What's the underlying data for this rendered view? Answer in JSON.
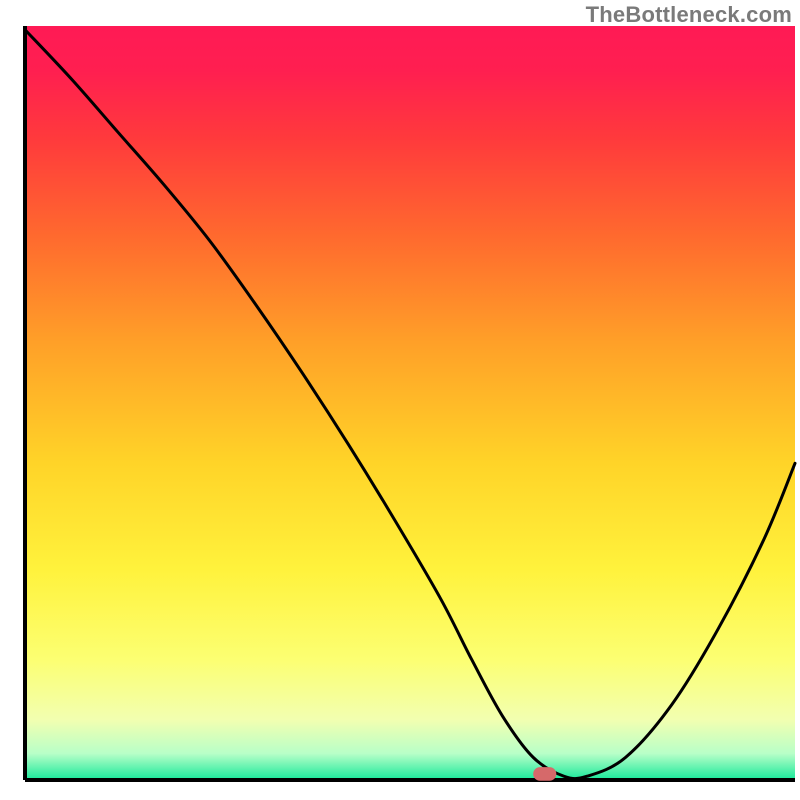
{
  "watermark": "TheBottleneck.com",
  "chart_data": {
    "type": "line",
    "title": "",
    "xlabel": "",
    "ylabel": "",
    "xlim": [
      0,
      100
    ],
    "ylim": [
      0,
      100
    ],
    "background_gradient": {
      "stops": [
        {
          "offset": 0.0,
          "color": "#ff1a55"
        },
        {
          "offset": 0.06,
          "color": "#ff1f50"
        },
        {
          "offset": 0.15,
          "color": "#ff3a3c"
        },
        {
          "offset": 0.28,
          "color": "#ff6a2e"
        },
        {
          "offset": 0.42,
          "color": "#ffa028"
        },
        {
          "offset": 0.58,
          "color": "#ffd428"
        },
        {
          "offset": 0.72,
          "color": "#fff23c"
        },
        {
          "offset": 0.84,
          "color": "#fcff72"
        },
        {
          "offset": 0.92,
          "color": "#f2ffb0"
        },
        {
          "offset": 0.965,
          "color": "#b8ffc8"
        },
        {
          "offset": 1.0,
          "color": "#16e89a"
        }
      ]
    },
    "series": [
      {
        "name": "bottleneck-curve",
        "x": [
          0.0,
          6.0,
          12.0,
          18.0,
          24.0,
          30.0,
          36.0,
          42.0,
          48.0,
          54.0,
          58.0,
          62.0,
          66.0,
          70.0,
          73.0,
          78.0,
          84.0,
          90.0,
          96.0,
          100.0
        ],
        "y": [
          99.5,
          93.0,
          86.0,
          79.0,
          71.5,
          63.0,
          54.0,
          44.5,
          34.5,
          24.0,
          16.0,
          8.5,
          3.0,
          0.5,
          0.5,
          3.0,
          10.0,
          20.0,
          32.0,
          42.0
        ]
      }
    ],
    "marker": {
      "x": 67.5,
      "y": 0.8,
      "color": "#d6696a",
      "width": 3.0,
      "height": 1.8
    },
    "axes_color": "#000000"
  }
}
